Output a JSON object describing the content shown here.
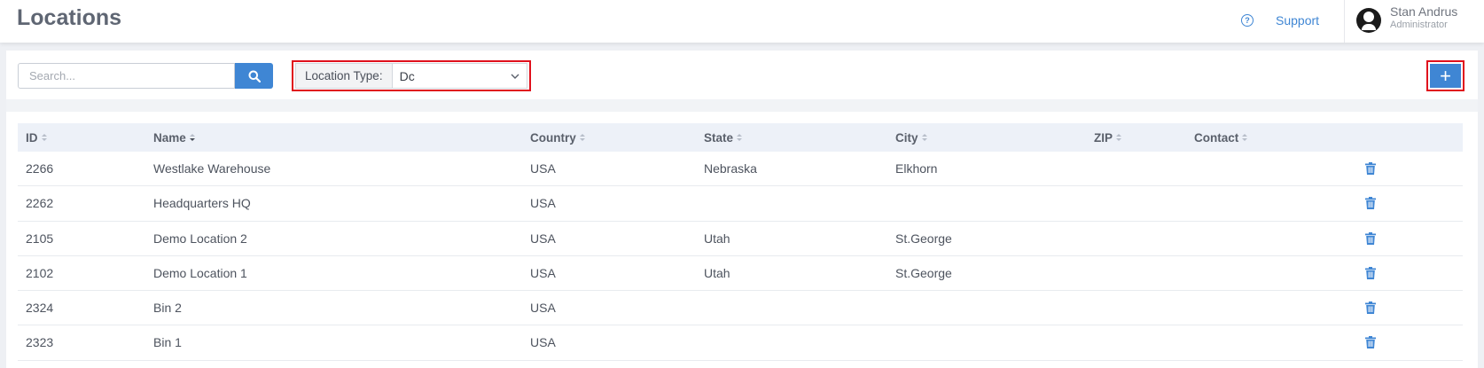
{
  "header": {
    "title": "Locations",
    "support_label": "Support",
    "user": {
      "name": "Stan Andrus",
      "role": "Administrator"
    }
  },
  "toolbar": {
    "search_placeholder": "Search...",
    "location_type_label": "Location Type:",
    "location_type_value": "Dc",
    "add_label": "+"
  },
  "table": {
    "columns": [
      "ID",
      "Name",
      "Country",
      "State",
      "City",
      "ZIP",
      "Contact"
    ],
    "rows": [
      {
        "id": "2266",
        "name": "Westlake Warehouse",
        "country": "USA",
        "state": "Nebraska",
        "city": "Elkhorn",
        "zip": "",
        "contact": ""
      },
      {
        "id": "2262",
        "name": "Headquarters HQ",
        "country": "USA",
        "state": "",
        "city": "",
        "zip": "",
        "contact": ""
      },
      {
        "id": "2105",
        "name": "Demo Location 2",
        "country": "USA",
        "state": "Utah",
        "city": "St.George",
        "zip": "",
        "contact": ""
      },
      {
        "id": "2102",
        "name": "Demo Location 1",
        "country": "USA",
        "state": "Utah",
        "city": "St.George",
        "zip": "",
        "contact": ""
      },
      {
        "id": "2324",
        "name": "Bin 2",
        "country": "USA",
        "state": "",
        "city": "",
        "zip": "",
        "contact": ""
      },
      {
        "id": "2323",
        "name": "Bin 1",
        "country": "USA",
        "state": "",
        "city": "",
        "zip": "",
        "contact": ""
      }
    ]
  },
  "colors": {
    "accent": "#3f86d4",
    "highlight": "#e0101c"
  }
}
